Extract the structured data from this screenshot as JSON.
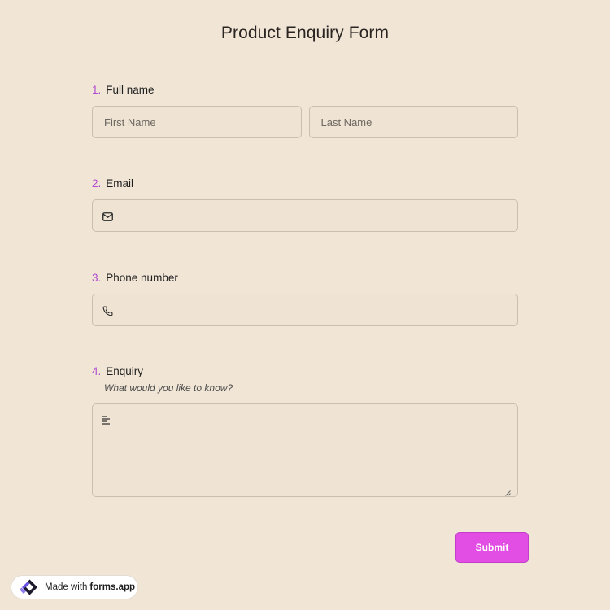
{
  "form": {
    "title": "Product Enquiry Form"
  },
  "questions": [
    {
      "number": "1.",
      "label": "Full name",
      "first_placeholder": "First Name",
      "last_placeholder": "Last Name"
    },
    {
      "number": "2.",
      "label": "Email",
      "icon": "mail-icon",
      "value": ""
    },
    {
      "number": "3.",
      "label": "Phone number",
      "icon": "phone-icon",
      "value": ""
    },
    {
      "number": "4.",
      "label": "Enquiry",
      "description": "What would you like to know?",
      "icon": "text-lines-icon",
      "value": ""
    }
  ],
  "submit": {
    "label": "Submit"
  },
  "badge": {
    "made_with": "Made with",
    "brand": "forms.app"
  },
  "colors": {
    "background": "#f1e6d6",
    "accent": "#e24ee4",
    "number": "#b04ad0",
    "border": "#c9bfae"
  }
}
